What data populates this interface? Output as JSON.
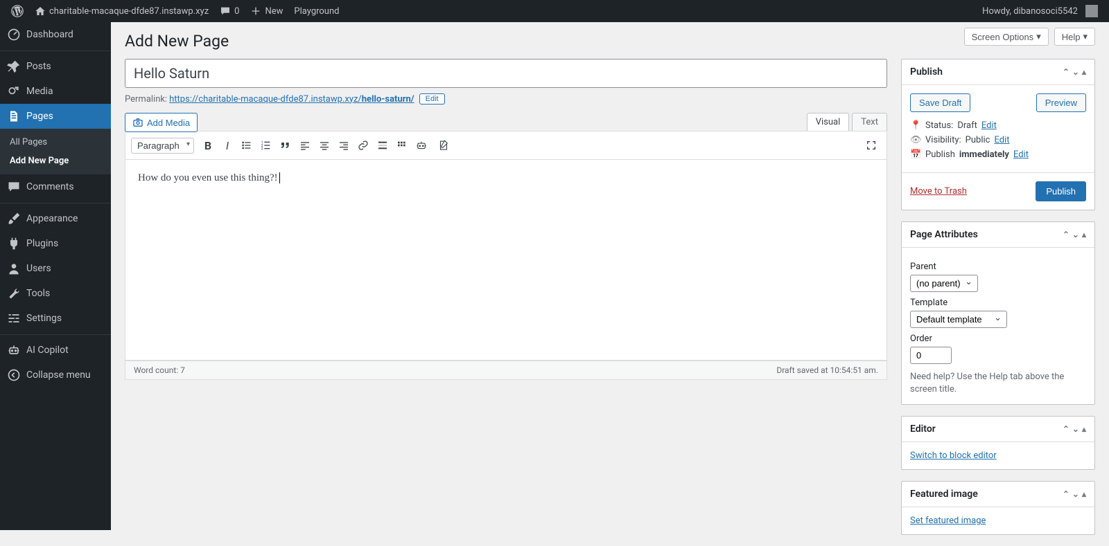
{
  "adminbar": {
    "site": "charitable-macaque-dfde87.instawp.xyz",
    "comments": "0",
    "new": "New",
    "playground": "Playground",
    "howdy": "Howdy, dibanosoci5542"
  },
  "sidebar": {
    "dashboard": "Dashboard",
    "posts": "Posts",
    "media": "Media",
    "pages": "Pages",
    "all_pages": "All Pages",
    "add_new": "Add New Page",
    "comments": "Comments",
    "appearance": "Appearance",
    "plugins": "Plugins",
    "users": "Users",
    "tools": "Tools",
    "settings": "Settings",
    "ai_copilot": "AI Copilot",
    "collapse": "Collapse menu"
  },
  "header": {
    "screen_options": "Screen Options",
    "help": "Help",
    "page_title": "Add New Page"
  },
  "editor": {
    "title": "Hello Saturn",
    "permalink_label": "Permalink:",
    "permalink_base": "https://charitable-macaque-dfde87.instawp.xyz/",
    "permalink_slug": "hello-saturn/",
    "edit_btn": "Edit",
    "add_media": "Add Media",
    "tab_visual": "Visual",
    "tab_text": "Text",
    "format_select": "Paragraph",
    "body": "How do you even use this thing?!",
    "word_count": "Word count: 7",
    "draft_saved": "Draft saved at 10:54:51 am."
  },
  "publish": {
    "title": "Publish",
    "save_draft": "Save Draft",
    "preview": "Preview",
    "status_label": "Status:",
    "status_value": "Draft",
    "status_edit": "Edit",
    "visibility_label": "Visibility:",
    "visibility_value": "Public",
    "visibility_edit": "Edit",
    "publish_label": "Publish",
    "publish_value": "immediately",
    "publish_edit": "Edit",
    "trash": "Move to Trash",
    "publish_btn": "Publish"
  },
  "page_attributes": {
    "title": "Page Attributes",
    "parent_label": "Parent",
    "parent_value": "(no parent)",
    "template_label": "Template",
    "template_value": "Default template",
    "order_label": "Order",
    "order_value": "0",
    "help": "Need help? Use the Help tab above the screen title."
  },
  "editor_box": {
    "title": "Editor",
    "switch": "Switch to block editor"
  },
  "featured": {
    "title": "Featured image",
    "set": "Set featured image"
  }
}
